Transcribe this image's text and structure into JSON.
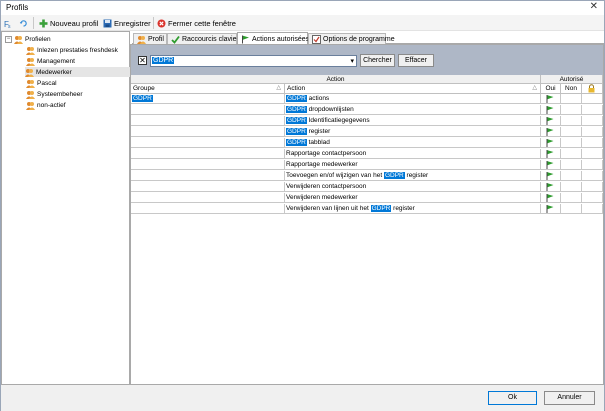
{
  "window": {
    "title": "Profils",
    "close_glyph": "✕"
  },
  "toolbar": {
    "new_profile": "Nouveau profil",
    "save": "Enregistrer",
    "close_window": "Fermer cette fenêtre"
  },
  "tree": {
    "root": "Profielen",
    "expander": "−",
    "items": [
      "Inlezen prestaties freshdesk",
      "Management",
      "Medewerker",
      "Pascal",
      "Systeembeheer",
      "non-actief"
    ],
    "selected": "Medewerker"
  },
  "tabs": [
    "Profil",
    "Raccourcis clavier",
    "Actions autorisées",
    "Options de programme"
  ],
  "active_tab": "Actions autorisées",
  "filter": {
    "checked_glyph": "✕",
    "value": "GDPR",
    "dropdown_glyph": "▾",
    "search_button": "Chercher",
    "clear_button": "Effacer"
  },
  "grid": {
    "band_action": "Action",
    "band_authorized": "Autorisé",
    "col_group": "Groupe",
    "col_action": "Action",
    "col_yes": "Oui",
    "col_no": "Non",
    "sort_glyph": "△",
    "rows": [
      {
        "group": "GDPR",
        "action_pre": "",
        "action_hl": "GDPR",
        "action_post": " actions"
      },
      {
        "group": "",
        "action_pre": "",
        "action_hl": "GDPR",
        "action_post": " dropdownlijsten"
      },
      {
        "group": "",
        "action_pre": "",
        "action_hl": "GDPR",
        "action_post": " Identificatiegegevens"
      },
      {
        "group": "",
        "action_pre": "",
        "action_hl": "GDPR",
        "action_post": " register"
      },
      {
        "group": "",
        "action_pre": "",
        "action_hl": "GDPR",
        "action_post": " tabblad"
      },
      {
        "group": "",
        "action_pre": "Rapportage contactpersoon",
        "action_hl": "",
        "action_post": ""
      },
      {
        "group": "",
        "action_pre": "Rapportage medewerker",
        "action_hl": "",
        "action_post": ""
      },
      {
        "group": "",
        "action_pre": "Toevoegen en/of wijzigen van het ",
        "action_hl": "GDPR",
        "action_post": " register"
      },
      {
        "group": "",
        "action_pre": "Verwijderen contactpersoon",
        "action_hl": "",
        "action_post": ""
      },
      {
        "group": "",
        "action_pre": "Verwijderen medewerker",
        "action_hl": "",
        "action_post": ""
      },
      {
        "group": "",
        "action_pre": "Verwijderen van lijnen uit het ",
        "action_hl": "GDPR",
        "action_post": " register"
      }
    ]
  },
  "footer": {
    "ok": "Ok",
    "cancel": "Annuler"
  },
  "colors": {
    "accent": "#0078d7",
    "filter_band": "#aeb7c6",
    "flag": "#2e9c2e"
  }
}
